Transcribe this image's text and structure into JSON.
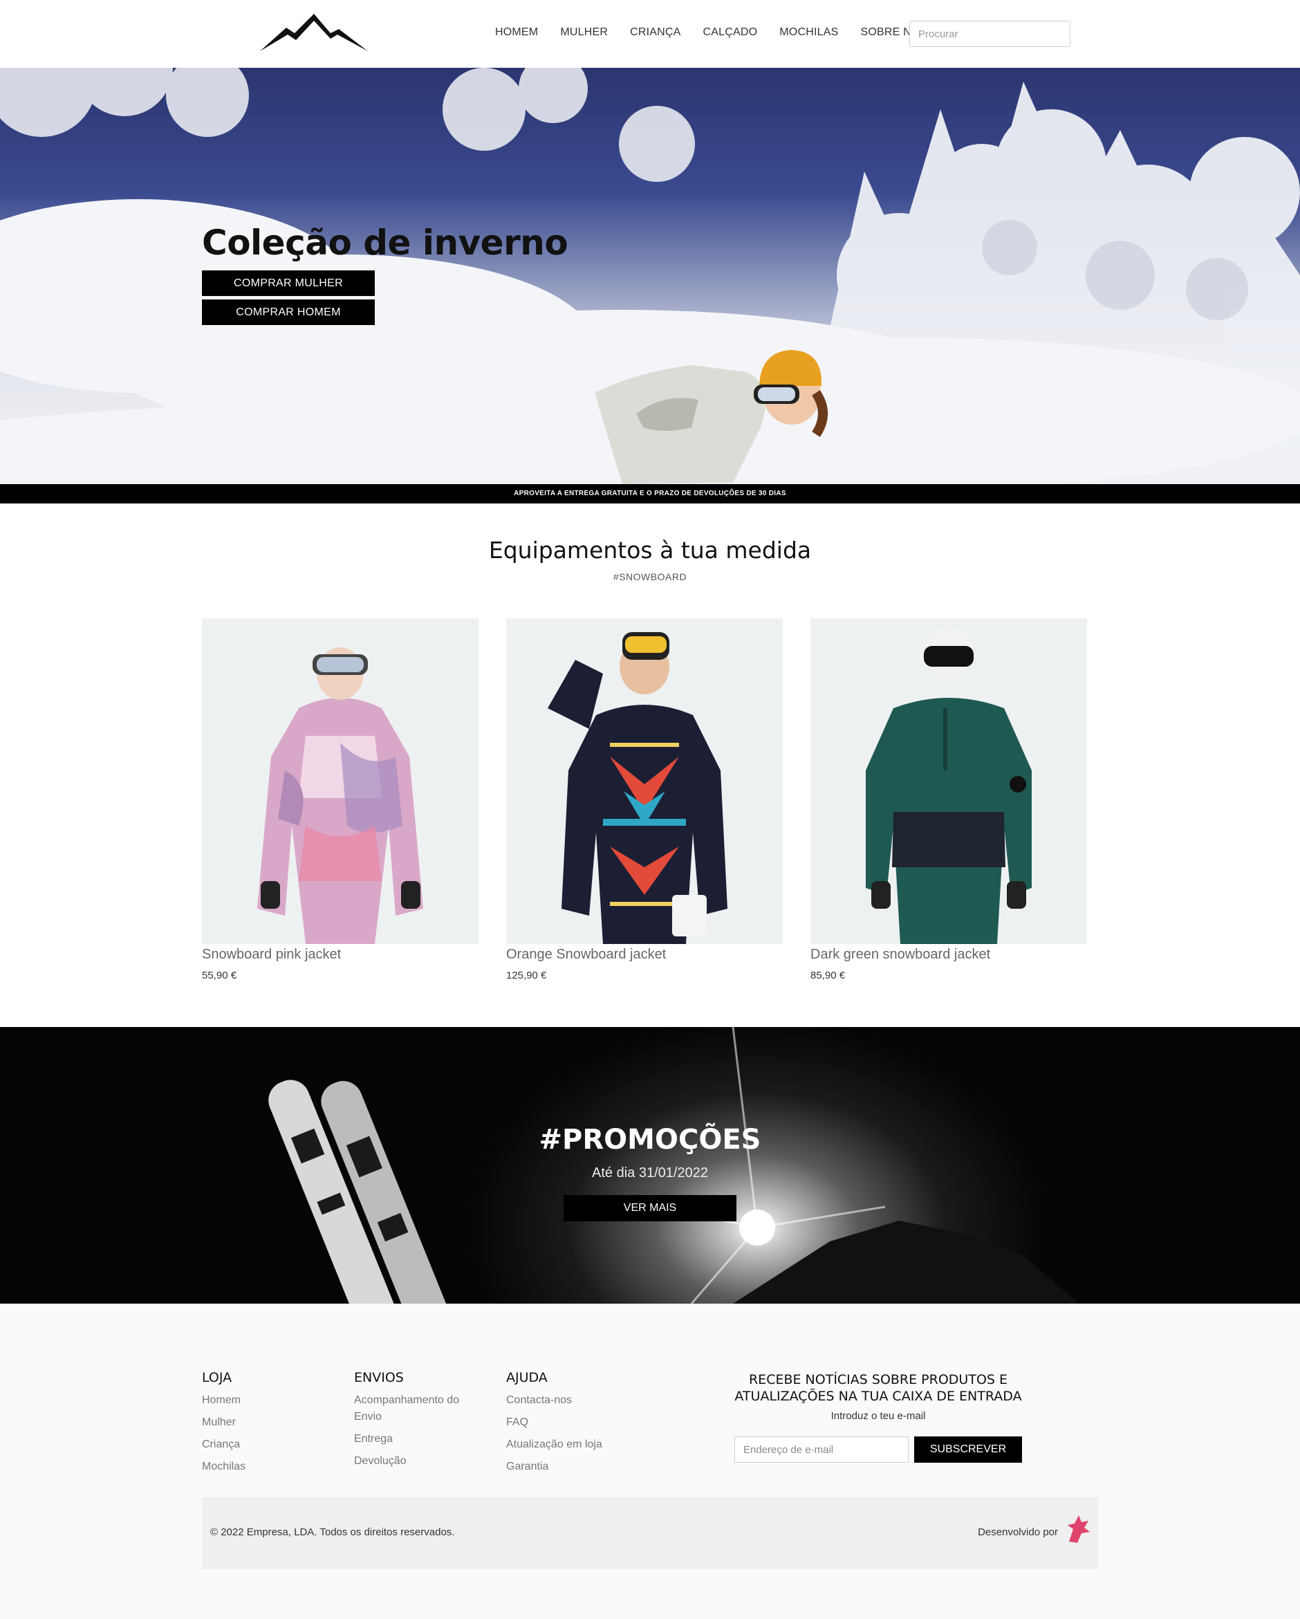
{
  "header": {
    "nav": [
      "HOMEM",
      "MULHER",
      "CRIANÇA",
      "CALÇADO",
      "MOCHILAS",
      "SOBRE NÓS"
    ],
    "search_placeholder": "Procurar"
  },
  "hero": {
    "title": "Coleção de inverno",
    "buttons": [
      "COMPRAR MULHER",
      "COMPRAR HOMEM"
    ]
  },
  "strip": {
    "text": "APROVEITA A ENTREGA GRATUITA E O PRAZO DE DEVOLUÇÕES DE 30 DIAS"
  },
  "products": {
    "title": "Equipamentos à tua medida",
    "tag": "#SNOWBOARD",
    "items": [
      {
        "name": "Snowboard pink jacket",
        "price": "55,90 €"
      },
      {
        "name": "Orange Snowboard jacket",
        "price": "125,90 €"
      },
      {
        "name": "Dark green snowboard jacket",
        "price": "85,90 €"
      }
    ]
  },
  "promo": {
    "title": "#PROMOÇÕES",
    "date": "Até dia 31/01/2022",
    "button": "VER MAIS"
  },
  "footer": {
    "loja": {
      "title": "LOJA",
      "links": [
        "Homem",
        "Mulher",
        "Criança",
        "Mochilas"
      ]
    },
    "envios": {
      "title": "ENVIOS",
      "links": [
        "Acompanhamento do Envio",
        "Entrega",
        "Devolução"
      ]
    },
    "ajuda": {
      "title": "AJUDA",
      "links": [
        "Contacta-nos",
        "FAQ",
        "Atualização em loja",
        "Garantia"
      ]
    },
    "newsletter": {
      "title": "RECEBE NOTÍCIAS SOBRE PRODUTOS E ATUALIZAÇÕES NA TUA CAIXA DE ENTRADA",
      "subtitle": "Introduz o teu e-mail",
      "placeholder": "Endereço de e-mail",
      "button": "SUBSCREVER"
    },
    "copyright": "© 2022 Empresa, LDA. Todos os direitos reservados.",
    "developed_by": "Desenvolvido por"
  },
  "colors": {
    "accent": "#000000",
    "developer_logo": "#e0436b"
  }
}
